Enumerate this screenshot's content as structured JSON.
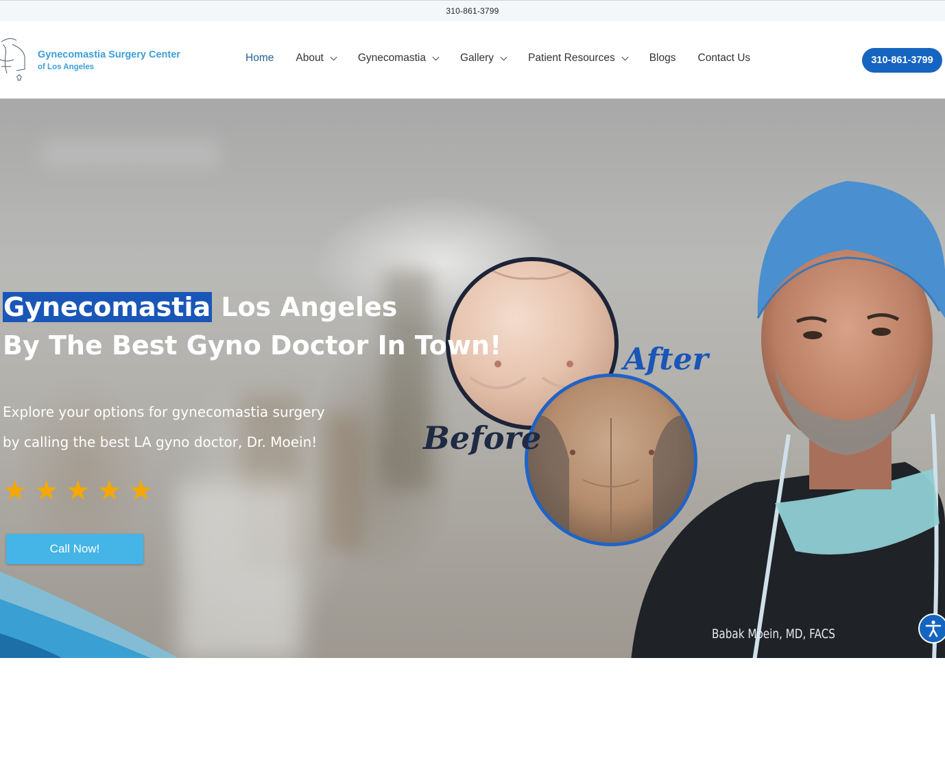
{
  "topbar": {
    "phone": "310-861-3799"
  },
  "logo": {
    "line1": "Gynecomastia Surgery Center",
    "line2": "of Los Angeles"
  },
  "nav": {
    "items": [
      {
        "label": "Home",
        "has_dropdown": false,
        "active": true
      },
      {
        "label": "About",
        "has_dropdown": true,
        "active": false
      },
      {
        "label": "Gynecomastia",
        "has_dropdown": true,
        "active": false
      },
      {
        "label": "Gallery",
        "has_dropdown": true,
        "active": false
      },
      {
        "label": "Patient Resources",
        "has_dropdown": true,
        "active": false
      },
      {
        "label": "Blogs",
        "has_dropdown": false,
        "active": false
      },
      {
        "label": "Contact Us",
        "has_dropdown": false,
        "active": false
      }
    ]
  },
  "header_cta": {
    "label": "310-861-3799"
  },
  "hero": {
    "title_highlight": "Gynecomastia",
    "title_rest": " Los Angeles",
    "title_line2": "By The Best Gyno Doctor In Town!",
    "subtitle_line1": "Explore your options for gynecomastia surgery",
    "subtitle_line2": "by calling the best LA gyno doctor, Dr. Moein!",
    "rating_stars": 5,
    "star_glyph": "★",
    "button_label": "Call Now!",
    "before_label": "Before",
    "after_label": "After",
    "doctor_scrub_text": "Babak Moein, MD, FACS"
  },
  "colors": {
    "brand_blue": "#1565c0",
    "logo_blue": "#3b9ed8",
    "button_blue": "#45b4e6",
    "star_gold": "#f5a800",
    "highlight_blue": "#1a56b8"
  },
  "icons": {
    "accessibility": "accessibility-icon",
    "dropdown": "chevron-down-icon",
    "star": "star-icon"
  }
}
